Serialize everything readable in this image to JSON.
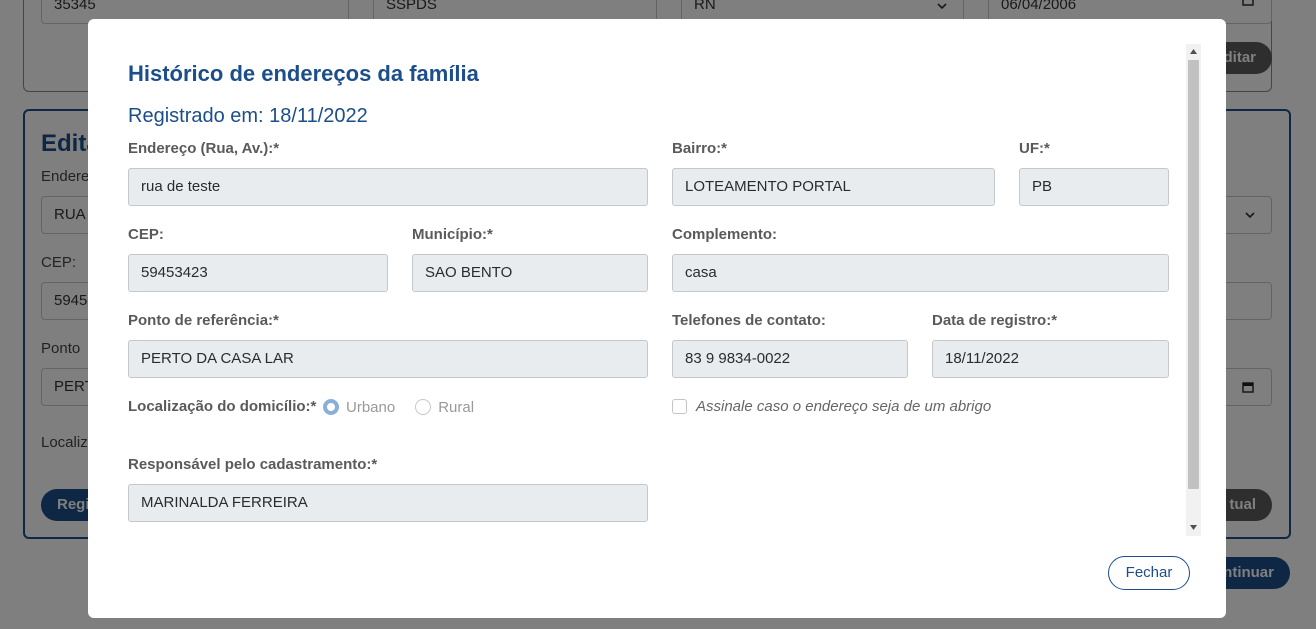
{
  "background": {
    "top_fields": [
      "35345",
      "SSPDS",
      "RN",
      "06/04/2006"
    ],
    "top_button": "Editar",
    "edit_title": "Edita",
    "edit_label_endereco": "Endere",
    "edit_value_endereco": "RUA",
    "edit_label_cep": "CEP:",
    "edit_value_cep": "5945",
    "edit_label_ponto": "Ponto",
    "edit_value_ponto": "PERT",
    "edit_label_localiz": "Localiz",
    "register_button": "Regi",
    "update_button": "tual",
    "continue_button": "ntinuar"
  },
  "modal": {
    "title": "Histórico de endereços da família",
    "subtitle": "Registrado em: 18/11/2022",
    "fields": {
      "endereco": {
        "label": "Endereço (Rua, Av.):*",
        "value": "rua de teste"
      },
      "bairro": {
        "label": "Bairro:*",
        "value": "LOTEAMENTO PORTAL"
      },
      "uf": {
        "label": "UF:*",
        "value": "PB"
      },
      "cep": {
        "label": "CEP:",
        "value": "59453423"
      },
      "municipio": {
        "label": "Município:*",
        "value": "SAO BENTO"
      },
      "complemento": {
        "label": "Complemento:",
        "value": "casa"
      },
      "ponto_referencia": {
        "label": "Ponto de referência:*",
        "value": "PERTO DA CASA LAR"
      },
      "telefones": {
        "label": "Telefones de contato:",
        "value": "83 9 9834-0022"
      },
      "data_registro": {
        "label": "Data de registro:*",
        "value": "18/11/2022"
      },
      "responsavel": {
        "label": "Responsável pelo cadastramento:*",
        "value": "MARINALDA FERREIRA"
      }
    },
    "localizacao": {
      "label": "Localização do domicílio:*",
      "options": [
        "Urbano",
        "Rural"
      ],
      "selected": "Urbano"
    },
    "abrigo_checkbox": {
      "label": "Assinale caso o endereço seja de um abrigo",
      "checked": false
    },
    "close_button": "Fechar"
  },
  "colors": {
    "accent": "#1c4e8a",
    "input_bg": "#e9ecef",
    "overlay": "rgba(0,0,0,0.5)"
  }
}
